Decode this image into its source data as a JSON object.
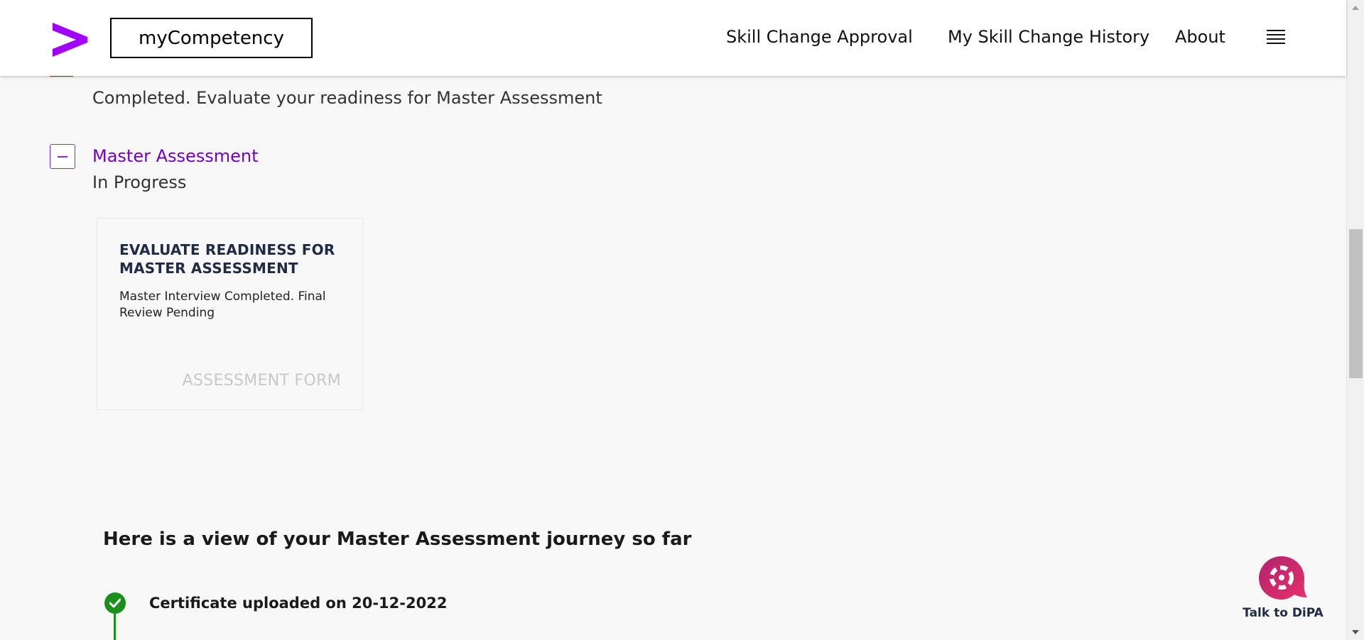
{
  "header": {
    "app_title": "myCompetency",
    "nav": {
      "skill_change_approval": "Skill Change Approval",
      "skill_change_history": "My Skill Change History",
      "about": "About"
    },
    "logo_icon": "accenture-chevron-logo",
    "menu_icon": "hamburger-menu-icon"
  },
  "colors": {
    "brand_purple": "#a100ff",
    "step_title_purple": "#7500c0",
    "success_green": "#1a8f1a",
    "chatbot_pink": "#d6246e"
  },
  "steps": {
    "previous_status": "Completed. Evaluate your readiness for Master Assessment",
    "current": {
      "title": "Master Assessment",
      "status": "In Progress"
    }
  },
  "card": {
    "title": "EVALUATE READINESS FOR MASTER ASSESSMENT",
    "description": "Master Interview Completed. Final Review Pending",
    "link": "ASSESSMENT FORM"
  },
  "journey": {
    "heading": "Here is a view of your Master Assessment journey so far",
    "events": [
      {
        "text": "Certificate uploaded on 20-12-2022",
        "state": "completed"
      }
    ]
  },
  "chatbot": {
    "label": "Talk to DiPA"
  }
}
